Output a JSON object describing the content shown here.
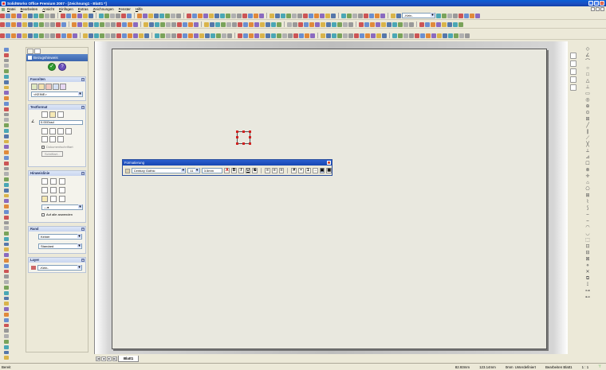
{
  "window": {
    "title": "SolidWorks Office Premium 2007 - [Zeichnung1 - Blatt1 *]"
  },
  "menu": [
    "Datei",
    "Bearbeiten",
    "Ansicht",
    "Einfügen",
    "Extras",
    "Zeichnungen",
    "Fenster",
    "Hilfe"
  ],
  "layer_combo": "-Kein-",
  "property_manager": {
    "title": "Bezugshinweis",
    "favorites": {
      "header": "Favoriten",
      "selected": "<KEINE>"
    },
    "text_format": {
      "header": "Textformat",
      "angle": "0.00Grad",
      "use_doc_font": "Dokumentschriftart",
      "font_button": "Schriftart..."
    },
    "leader": {
      "header": "Hinweislinie",
      "apply_all": "Auf alle anwenden"
    },
    "frame": {
      "header": "Rand",
      "style": "Keiner",
      "size": "Standard"
    },
    "layer": {
      "header": "Layer",
      "selected": "-Kein-"
    }
  },
  "formatting": {
    "title": "Formatierung",
    "font": "Century Gothic",
    "size": "11",
    "height": "3.5mm"
  },
  "sheet_tab": "Blatt1",
  "status": {
    "left": "Bereit",
    "x": "82.93mm",
    "y": "123.14mm",
    "z": "0mm",
    "state": "Unterdefiniert",
    "editing": "Bearbeiten Blatt1",
    "scale": "1 : 1"
  },
  "colors": {
    "title_bar": "#1c4fc0",
    "accent_red": "#d12020",
    "sheet": "#e9e8df"
  }
}
